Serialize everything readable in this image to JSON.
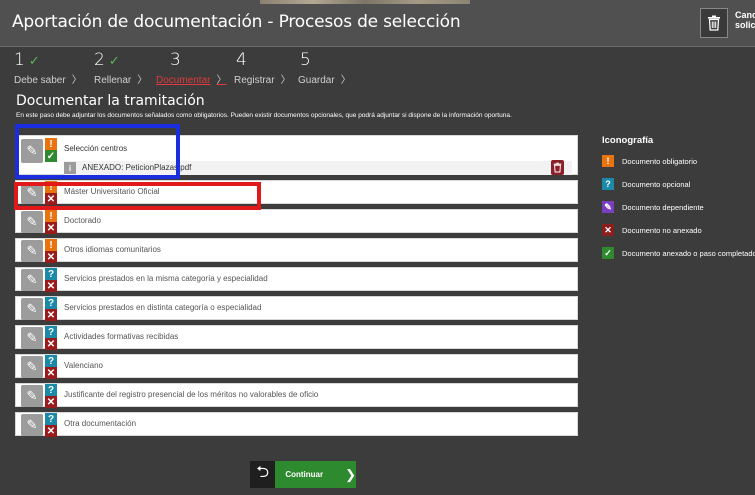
{
  "header": {
    "title": "Aportación de documentación - Procesos de selección",
    "cancel_label_line1": "Cance",
    "cancel_label_line2": "solicitu"
  },
  "steps": [
    {
      "num": "1",
      "label": "Debe saber",
      "done": true
    },
    {
      "num": "2",
      "label": "Rellenar",
      "done": true
    },
    {
      "num": "3",
      "label": "Documentar",
      "done": false,
      "active": true
    },
    {
      "num": "4",
      "label": "Registrar",
      "done": false
    },
    {
      "num": "5",
      "label": "Guardar",
      "done": false
    }
  ],
  "section": {
    "title": "Documentar la tramitación",
    "description": "En este paso debe adjuntar los documentos señalados como obligatorios. Pueden existir documentos opcionales, que podrá adjuntar si dispone de la información oportuna."
  },
  "documents": [
    {
      "label": "Selección centros",
      "type": "obligatorio",
      "status": "anexado",
      "attachment": "ANEXADO: PeticionPlazas.pdf"
    },
    {
      "label": "Máster Universitario Oficial",
      "type": "obligatorio",
      "status": "no_anexado"
    },
    {
      "label": "Doctorado",
      "type": "obligatorio",
      "status": "no_anexado"
    },
    {
      "label": "Otros idiomas comunitarios",
      "type": "obligatorio",
      "status": "no_anexado"
    },
    {
      "label": "Servicios prestados en la misma categoría y especialidad",
      "type": "opcional",
      "status": "no_anexado"
    },
    {
      "label": "Servicios prestados en distinta categoría o especialidad",
      "type": "opcional",
      "status": "no_anexado"
    },
    {
      "label": "Actividades formativas recibidas",
      "type": "opcional",
      "status": "no_anexado"
    },
    {
      "label": "Valenciano",
      "type": "opcional",
      "status": "no_anexado"
    },
    {
      "label": "Justificante del registro presencial de los méritos no valorables de oficio",
      "type": "opcional",
      "status": "no_anexado"
    },
    {
      "label": "Otra documentación",
      "type": "opcional",
      "status": "no_anexado"
    }
  ],
  "legend": {
    "title": "Iconografía",
    "items": [
      {
        "label": "Documento obligatorio",
        "symbol": "!",
        "color": "#e8730f"
      },
      {
        "label": "Documento opcional",
        "symbol": "?",
        "color": "#1a8aa8"
      },
      {
        "label": "Documento dependiente",
        "symbol": "pencil-icon",
        "color": "#7a3fbf"
      },
      {
        "label": "Documento no anexado",
        "symbol": "x",
        "color": "#8b1f1f"
      },
      {
        "label": "Documento anexado o paso completado",
        "symbol": "check",
        "color": "#2f8a2f"
      }
    ]
  },
  "footer": {
    "continue_label": "Continuar"
  },
  "colors": {
    "header_bg": "#505050",
    "page_bg": "#3c3c3c",
    "active_step": "#e03a3a",
    "check_green": "#5cb85c",
    "highlight_blue": "#1a2ee0",
    "highlight_red": "#e01a1a"
  }
}
